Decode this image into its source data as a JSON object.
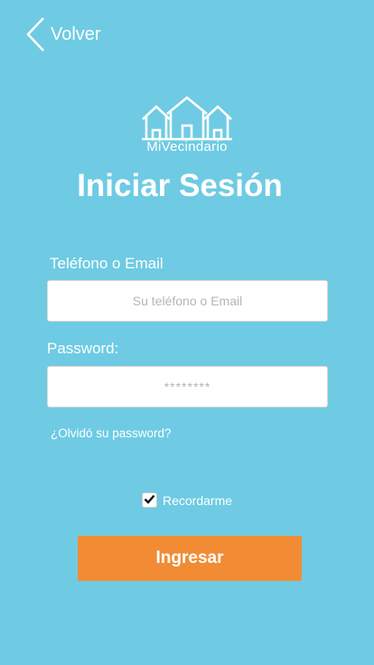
{
  "header": {
    "back_label": "Volver",
    "back_icon": "chevron-left-icon"
  },
  "logo": {
    "icon": "houses-icon",
    "text": "MiVecindario"
  },
  "title": "Iniciar Sesión",
  "form": {
    "phone_label": "Teléfono o Email",
    "phone_placeholder": "Su teléfono o Email",
    "phone_value": "",
    "password_label": "Password:",
    "password_placeholder": "********",
    "password_value": "",
    "forgot_link": "¿Olvidó su password?",
    "remember_label": "Recordarme",
    "remember_checked": true,
    "submit_label": "Ingresar"
  },
  "colors": {
    "background": "#6ecbe3",
    "button": "#f18c35",
    "text": "#ffffff"
  }
}
